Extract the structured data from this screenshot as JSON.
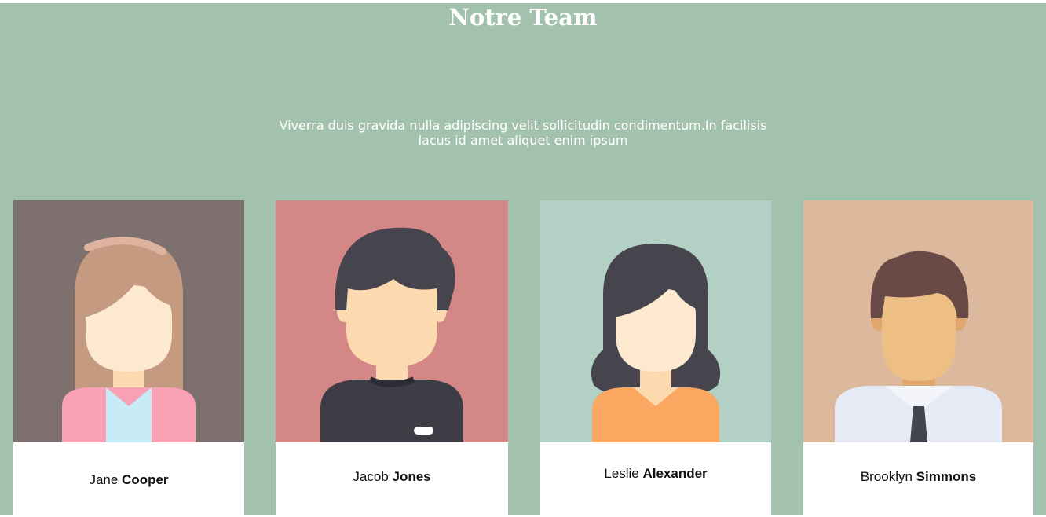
{
  "header": {
    "title": "Notre Team",
    "subtitle_line1": "Viverra duis gravida nulla adipiscing velit sollicitudin condimentum.In facilisis",
    "subtitle_line2": "lacus id amet aliquet enim ipsum"
  },
  "team": [
    {
      "first": "Jane",
      "last": "Cooper",
      "avatar": "woman-long-hair-avatar",
      "bg": "#7e706f"
    },
    {
      "first": "Jacob",
      "last": "Jones",
      "avatar": "man-dark-sweater-avatar",
      "bg": "#d38786"
    },
    {
      "first": "Leslie",
      "last": "Alexander",
      "avatar": "woman-dark-hair-avatar",
      "bg": "#b2d1c4"
    },
    {
      "first": "Brooklyn",
      "last": "Simmons",
      "avatar": "man-shirt-tie-avatar",
      "bg": "#dcb89c"
    }
  ],
  "colors": {
    "section_bg": "#a3c2ae",
    "card_bg": "#ffffff"
  }
}
